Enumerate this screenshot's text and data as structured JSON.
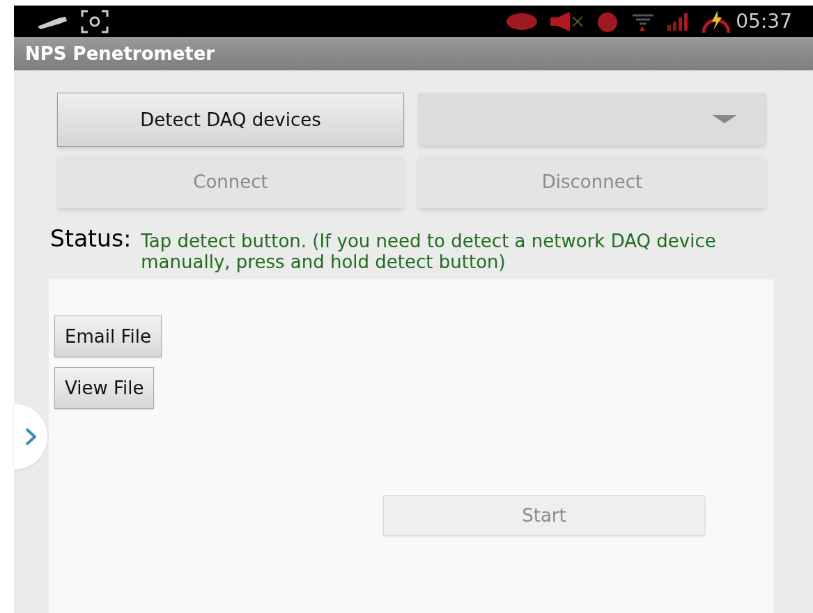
{
  "status_bar": {
    "time": "05:37"
  },
  "title": "NPS Penetrometer",
  "top_buttons": [
    {
      "label": "Detect DAQ devices",
      "disabled": false
    },
    {
      "label": "Connect",
      "disabled": true
    },
    {
      "label": "Disconnect",
      "disabled": true
    }
  ],
  "status": {
    "label": "Status:",
    "message": "Tap detect button. (If you need to detect a network DAQ device manually, press and hold detect button)"
  },
  "file_buttons": [
    {
      "label": "Email File",
      "disabled": false
    },
    {
      "label": "View File",
      "disabled": false
    }
  ],
  "start_button": {
    "label": "Start",
    "disabled": true
  }
}
